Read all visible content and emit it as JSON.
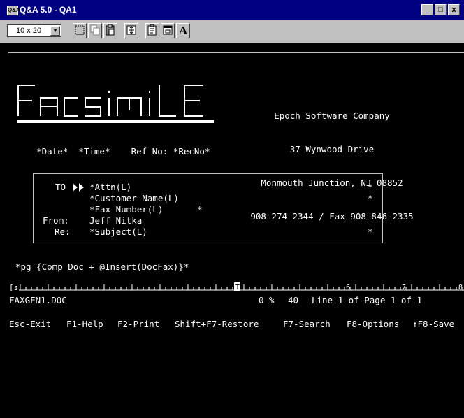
{
  "window": {
    "app_icon_text": "Q&A",
    "title": "Q&A 5.0 - QA1",
    "controls": [
      "_",
      "□",
      "x"
    ]
  },
  "toolbar": {
    "font_size": "10 x 20",
    "font_letter": "A"
  },
  "letterhead": {
    "logo_text": "FACSIMILE",
    "company_name": "Epoch Software Company",
    "address1": "37 Wynwood Drive",
    "address2": "Monmouth Junction, NJ 08852",
    "phone": "908-274-2344 / Fax 908-846-2335"
  },
  "dateline": {
    "date": "*Date*",
    "time": "*Time*",
    "ref": "Ref No: *RecNo*"
  },
  "fax_box": {
    "to_label": "TO",
    "attn": "*Attn(L)",
    "customer": "*Customer Name(L)",
    "fax_number": "*Fax Number(L)",
    "fax_marker": "*",
    "from_label": "From:",
    "from_value": "Jeff Nitka",
    "re_label": "Re:",
    "subject": "*Subject(L)",
    "right_marker": "*"
  },
  "body": {
    "pg_line": "*pg {Comp Doc + @Insert(DocFax)}*"
  },
  "ruler": {
    "left_marker": "[s",
    "mark6": "6",
    "mark7": "7",
    "mark8": "8"
  },
  "status": {
    "filename": "FAXGEN1.DOC",
    "percent": "0 %",
    "column": "40",
    "position": "Line 1 of Page 1 of 1"
  },
  "fkeys": {
    "esc": "Esc-Exit",
    "f1": "F1-Help",
    "f2": "F2-Print",
    "sf7": "Shift+F7-Restore",
    "f7": "F7-Search",
    "f8": "F8-Options",
    "cf8": "↑F8-Save"
  }
}
